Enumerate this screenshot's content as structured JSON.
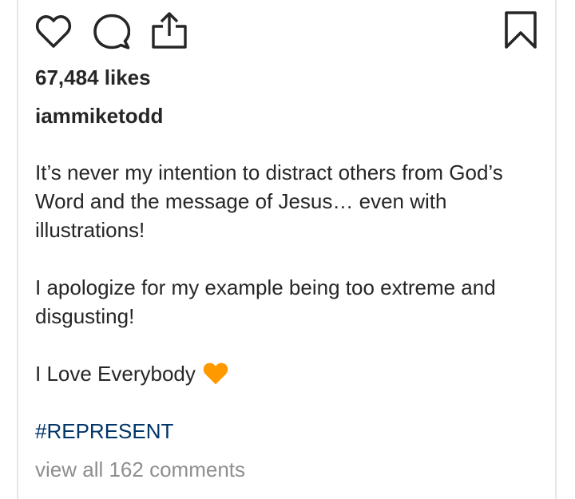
{
  "post": {
    "actions": {
      "like_icon": "heart-outline-icon",
      "comment_icon": "comment-bubble-icon",
      "share_icon": "share-upload-icon",
      "save_icon": "bookmark-outline-icon"
    },
    "likes_text": "67,484 likes",
    "username": "iammiketodd",
    "caption": {
      "paragraph_1": "It’s never my intention to distract others from God’s Word and the message of Jesus… even with illustrations!",
      "paragraph_2": "I apologize for my example being too extreme and disgusting!",
      "paragraph_3": "I Love Everybody",
      "emoji": "orange-heart-emoji"
    },
    "hashtag": "#REPRESENT",
    "view_comments": "view all 162 comments"
  },
  "colors": {
    "text": "#262626",
    "hashtag": "#003569",
    "muted": "#8e8e8e",
    "border": "#e6e6e6",
    "emoji_heart": "#ff9900"
  }
}
